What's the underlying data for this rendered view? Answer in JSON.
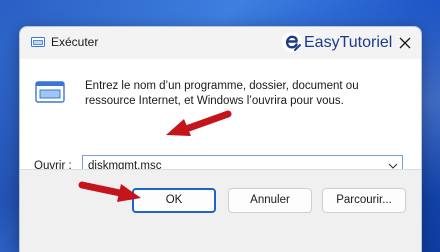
{
  "window": {
    "title": "Exécuter",
    "brand": "EasyTutoriel"
  },
  "content": {
    "description": "Entrez le nom d’un programme, dossier, document ou ressource Internet, et Windows l’ouvrira pour vous.",
    "open_label": "Ouvrir :",
    "open_value": "diskmgmt.msc"
  },
  "buttons": {
    "ok": "OK",
    "cancel": "Annuler",
    "browse": "Parcourir..."
  },
  "colors": {
    "annotation_arrow": "#c4141c",
    "focus_border": "#1e63c7",
    "brand_text": "#1c3a8a"
  },
  "icons": [
    "run-window-icon",
    "easytutoriel-logo",
    "close-icon",
    "run-program-icon",
    "chevron-down-icon",
    "annotation-arrow"
  ]
}
